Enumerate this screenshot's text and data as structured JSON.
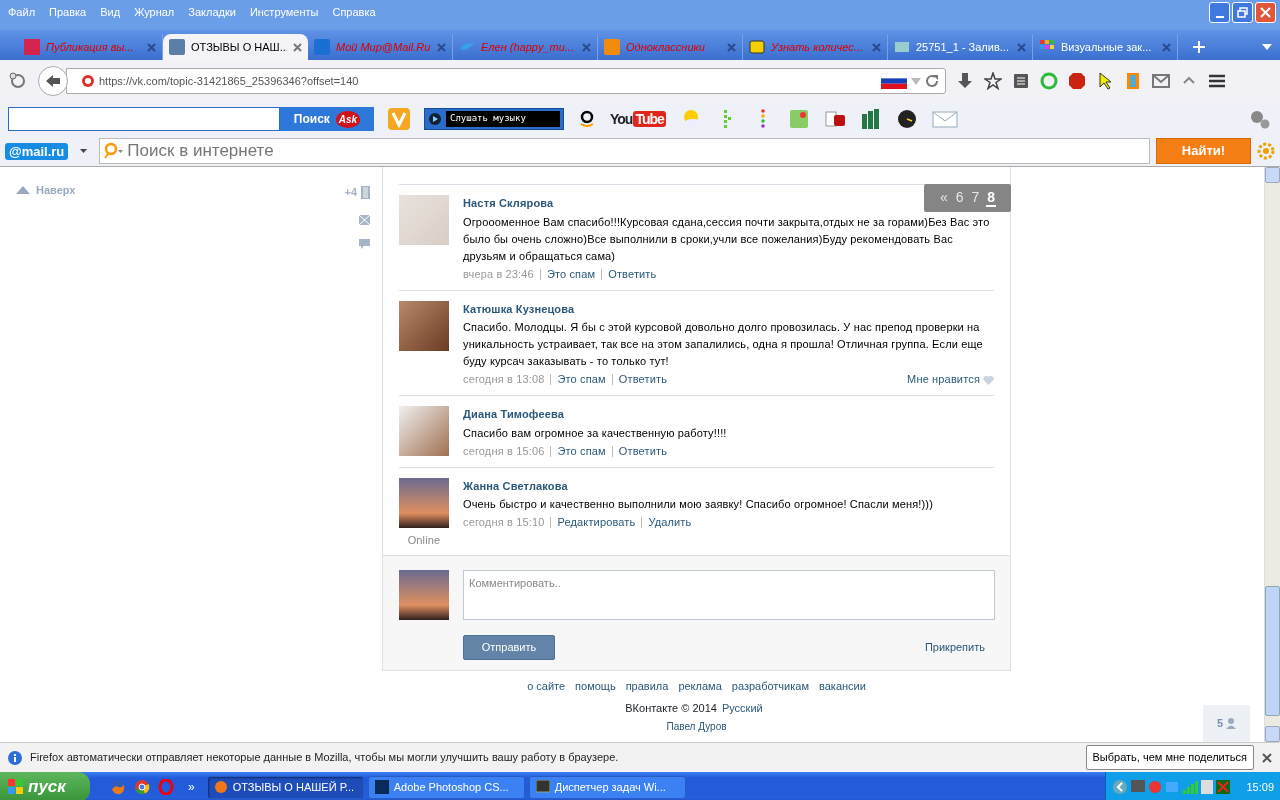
{
  "menu": [
    "Файл",
    "Правка",
    "Вид",
    "Журнал",
    "Закладки",
    "Инструменты",
    "Справка"
  ],
  "tabs": [
    {
      "title": "Публикация вы...",
      "selected": false,
      "unread": true
    },
    {
      "title": "ОТЗЫВЫ О НАШ...",
      "selected": true,
      "unread": false
    },
    {
      "title": "Мой Мир@Mail.Ru",
      "selected": false,
      "unread": true
    },
    {
      "title": "Елен (happy_mu...",
      "selected": false,
      "unread": true
    },
    {
      "title": "Одноклассники",
      "selected": false,
      "unread": true
    },
    {
      "title": "Узнать количес...",
      "selected": false,
      "unread": true
    },
    {
      "title": "25751_1 - Залив...",
      "selected": false,
      "unread": false
    },
    {
      "title": "Визуальные зак...",
      "selected": false,
      "unread": false
    }
  ],
  "url": "https://vk.com/topic-31421865_25396346?offset=140",
  "ask_toolbar": {
    "search_button": "Поиск",
    "logo": "Ask",
    "music": "Слушать музыку",
    "youtube": [
      "You",
      "Tube"
    ]
  },
  "mail_toolbar": {
    "logo": "@mail.ru",
    "placeholder": "Поиск в интернете",
    "button": "Найти!"
  },
  "sidebar": {
    "back_to_top": "Наверх",
    "counter": "+4"
  },
  "pager": [
    {
      "label": "«",
      "selected": false
    },
    {
      "label": "6",
      "selected": false
    },
    {
      "label": "7",
      "selected": false
    },
    {
      "label": "8",
      "selected": true
    }
  ],
  "comments": [
    {
      "author": "Настя Склярова",
      "text": "Огроооменное Вам спасибо!!!Курсовая сдана,сессия почти закрыта,отдых не за горами)Без Вас это было бы очень сложно)Все выполнили в сроки,учли все пожелания)Буду рекомендовать Вас друзьям и обращаться сама)",
      "time": "вчера в 23:46",
      "actions": [
        "Это спам",
        "Ответить"
      ]
    },
    {
      "author": "Катюшка Кузнецова",
      "text": "Спасибо. Молодцы. Я бы с этой курсовой довольно долго провозилась. У нас препод проверки на уникальность устраивает, так все на этом запалились, одна я прошла! Отличная группа. Если еще буду курсач заказывать - то только тут!",
      "time": "сегодня в 13:08",
      "actions": [
        "Это спам",
        "Ответить"
      ],
      "like": "Мне нравится"
    },
    {
      "author": "Диана Тимофеева",
      "text": "Спасибо вам огромное за качественную работу!!!!",
      "time": "сегодня в 15:06",
      "actions": [
        "Это спам",
        "Ответить"
      ]
    },
    {
      "author": "Жанна Светлакова",
      "text": "Очень быстро и качественно выполнили мою заявку! Спасибо огромное! Спасли меня!)))",
      "time": "сегодня в 15:10",
      "actions": [
        "Редактировать",
        "Удалить"
      ],
      "status": "Online"
    }
  ],
  "comment_form": {
    "placeholder": "Комментировать..",
    "submit": "Отправить",
    "attach": "Прикрепить"
  },
  "footer": {
    "links": [
      "о сайте",
      "помощь",
      "правила",
      "реклама",
      "разработчикам",
      "вакансии"
    ],
    "copyright": "ВКонтакте © 2014",
    "language": "Русский",
    "author": "Павел Дуров"
  },
  "online_count": "5",
  "notification": {
    "text": "Firefox автоматически отправляет некоторые данные в Mozilla, чтобы мы могли улучшить вашу работу в браузере.",
    "button": "Выбрать, чем мне поделиться"
  },
  "taskbar": {
    "start": "пуск",
    "more": "»",
    "tasks": [
      {
        "title": "ОТЗЫВЫ О НАШЕЙ Р...",
        "selected": true
      },
      {
        "title": "Adobe Photoshop CS...",
        "selected": false
      },
      {
        "title": "Диспетчер задач Wi...",
        "selected": false
      }
    ],
    "clock": "15:09"
  }
}
